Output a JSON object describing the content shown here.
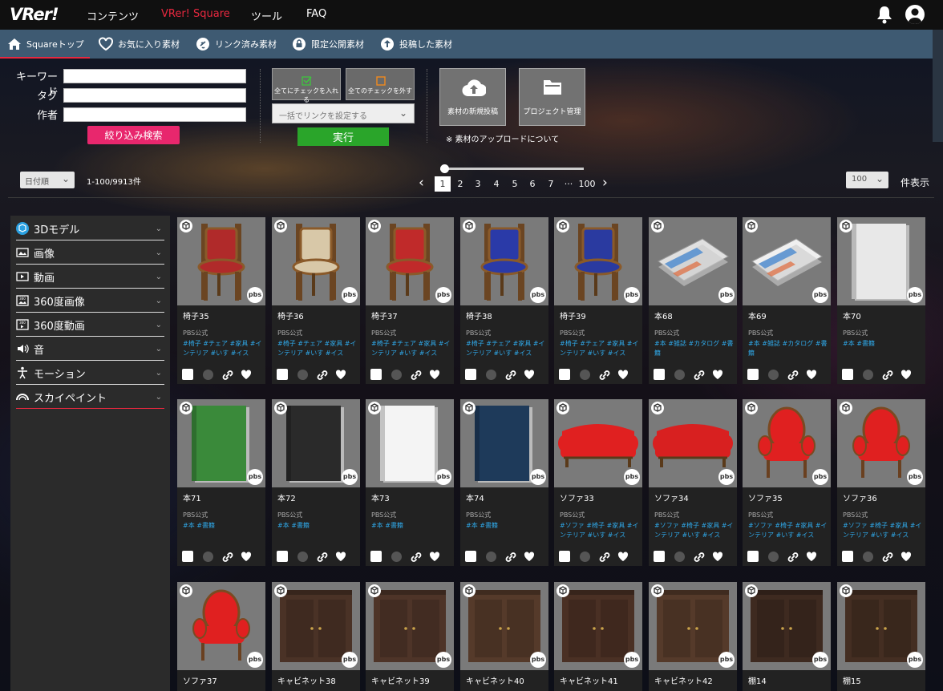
{
  "topnav": {
    "logo": "VRer!",
    "items": [
      "コンテンツ",
      "VRer! Square",
      "ツール",
      "FAQ"
    ],
    "active": "VRer! Square"
  },
  "subnav": {
    "items": [
      {
        "label": "Squareトップ",
        "icon": "home-icon"
      },
      {
        "label": "お気に入り素材",
        "icon": "heart-icon"
      },
      {
        "label": "リンク済み素材",
        "icon": "link-icon"
      },
      {
        "label": "限定公開素材",
        "icon": "lock-icon"
      },
      {
        "label": "投稿した素材",
        "icon": "upload-icon"
      }
    ]
  },
  "search": {
    "keyword_label": "キーワード",
    "tag_label": "タグ",
    "author_label": "作者",
    "keyword_value": "",
    "tag_value": "",
    "author_value": "",
    "submit": "絞り込み検索"
  },
  "bulk": {
    "check_all": "全てにチェックを入れる",
    "uncheck_all": "全てのチェックを外す",
    "link_select": "一括でリンクを設定する",
    "execute": "実行"
  },
  "actions": {
    "new_post": "素材の新規投稿",
    "project": "プロジェクト管理",
    "note": "※ 素材のアップロードについて"
  },
  "list": {
    "sort": "日付順",
    "count": "1-100/9913件",
    "pages": [
      "1",
      "2",
      "3",
      "4",
      "5",
      "6",
      "7",
      "···",
      "100"
    ],
    "current_page": "1",
    "per_page": "100",
    "per_page_label": "件表示"
  },
  "categories": [
    {
      "label": "3Dモデル",
      "icon": "cube-icon"
    },
    {
      "label": "画像",
      "icon": "image-icon"
    },
    {
      "label": "動画",
      "icon": "video-icon"
    },
    {
      "label": "360度画像",
      "icon": "360-image-icon"
    },
    {
      "label": "360度動画",
      "icon": "360-video-icon"
    },
    {
      "label": "音",
      "icon": "sound-icon"
    },
    {
      "label": "モーション",
      "icon": "motion-icon"
    },
    {
      "label": "スカイペイント",
      "icon": "skypaint-icon"
    }
  ],
  "cards": [
    {
      "title": "椅子35",
      "publisher": "PBS公式",
      "tags": "#椅子 #チェア #家具 #インテリア #いす #イス",
      "kind": "chair",
      "color": "#b02a2a"
    },
    {
      "title": "椅子36",
      "publisher": "PBS公式",
      "tags": "#椅子 #チェア #家具 #インテリア #いす #イス",
      "kind": "chair",
      "color": "#d8c8a8"
    },
    {
      "title": "椅子37",
      "publisher": "PBS公式",
      "tags": "#椅子 #チェア #家具 #インテリア #いす #イス",
      "kind": "chair",
      "color": "#c02a2a"
    },
    {
      "title": "椅子38",
      "publisher": "PBS公式",
      "tags": "#椅子 #チェア #家具 #インテリア #いす #イス",
      "kind": "chair",
      "color": "#2a3aa8"
    },
    {
      "title": "椅子39",
      "publisher": "PBS公式",
      "tags": "#椅子 #チェア #家具 #インテリア #いす #イス",
      "kind": "chair",
      "color": "#2a3aa0"
    },
    {
      "title": "本68",
      "publisher": "PBS公式",
      "tags": "#本 #雑誌 #カタログ #書籍",
      "kind": "mag",
      "color": "#e0e0e0"
    },
    {
      "title": "本69",
      "publisher": "PBS公式",
      "tags": "#本 #雑誌 #カタログ #書籍",
      "kind": "mag",
      "color": "#f0f0f0"
    },
    {
      "title": "本70",
      "publisher": "PBS公式",
      "tags": "#本 #書籍",
      "kind": "book",
      "color": "#e8e8e8"
    },
    {
      "title": "本71",
      "publisher": "PBS公式",
      "tags": "#本 #書籍",
      "kind": "book",
      "color": "#3a8a3a"
    },
    {
      "title": "本72",
      "publisher": "PBS公式",
      "tags": "#本 #書籍",
      "kind": "book",
      "color": "#2a2a2a"
    },
    {
      "title": "本73",
      "publisher": "PBS公式",
      "tags": "#本 #書籍",
      "kind": "book",
      "color": "#f4f4f4"
    },
    {
      "title": "本74",
      "publisher": "PBS公式",
      "tags": "#本 #書籍",
      "kind": "book",
      "color": "#1e3a5a"
    },
    {
      "title": "ソファ33",
      "publisher": "PBS公式",
      "tags": "#ソファ #椅子 #家具 #インテリア #いす #イス",
      "kind": "sofa",
      "color": "#e02020"
    },
    {
      "title": "ソファ34",
      "publisher": "PBS公式",
      "tags": "#ソファ #椅子 #家具 #インテリア #いす #イス",
      "kind": "sofa",
      "color": "#d82020"
    },
    {
      "title": "ソファ35",
      "publisher": "PBS公式",
      "tags": "#ソファ #椅子 #家具 #インテリア #いす #イス",
      "kind": "arm",
      "color": "#e02020"
    },
    {
      "title": "ソファ36",
      "publisher": "PBS公式",
      "tags": "#ソファ #椅子 #家具 #インテリア #いす #イス",
      "kind": "arm",
      "color": "#e02020"
    },
    {
      "title": "ソファ37",
      "publisher": "",
      "tags": "",
      "kind": "arm",
      "color": "#e02020"
    },
    {
      "title": "キャビネット38",
      "publisher": "",
      "tags": "",
      "kind": "cab",
      "color": "#4a3226"
    },
    {
      "title": "キャビネット39",
      "publisher": "",
      "tags": "",
      "kind": "cab",
      "color": "#4e3428"
    },
    {
      "title": "キャビネット40",
      "publisher": "",
      "tags": "",
      "kind": "cab",
      "color": "#553a2a"
    },
    {
      "title": "キャビネット41",
      "publisher": "",
      "tags": "",
      "kind": "cab",
      "color": "#4a3024"
    },
    {
      "title": "キャビネット42",
      "publisher": "",
      "tags": "",
      "kind": "cab",
      "color": "#553a2a"
    },
    {
      "title": "棚14",
      "publisher": "",
      "tags": "",
      "kind": "cab",
      "color": "#3e2a20"
    },
    {
      "title": "棚15",
      "publisher": "",
      "tags": "",
      "kind": "cab",
      "color": "#442e22"
    }
  ],
  "card_badge": "pbs"
}
